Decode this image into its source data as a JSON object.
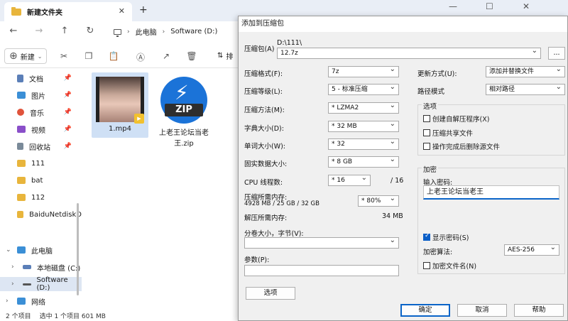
{
  "explorer": {
    "tab_title": "新建文件夹",
    "tab_close": "✕",
    "tab_add": "+",
    "win_min": "—",
    "win_max": "☐",
    "win_close": "✕",
    "nav": {
      "back": "←",
      "forward": "→",
      "up": "↑",
      "refresh": "↻"
    },
    "breadcrumb": [
      "此电脑",
      "Software (D:)"
    ],
    "breadcrumb_sep": "›",
    "toolbar": {
      "new_label": "新建",
      "sort_label": "排"
    },
    "sidebar": [
      {
        "label": "文档",
        "color": "#5b7fb8"
      },
      {
        "label": "图片",
        "color": "#3b8fd6"
      },
      {
        "label": "音乐",
        "color": "#e0533b"
      },
      {
        "label": "视频",
        "color": "#8a4fc9"
      },
      {
        "label": "回收站",
        "color": "#7a8a99"
      },
      {
        "label": "111",
        "color": "#e8b53c"
      },
      {
        "label": "bat",
        "color": "#e8b53c"
      },
      {
        "label": "112",
        "color": "#e8b53c"
      },
      {
        "label": "BaiduNetdiskD",
        "color": "#e8b53c"
      },
      {
        "label": "此电脑",
        "color": "#3b8fd6"
      },
      {
        "label": "本地磁盘 (C:)",
        "color": "#5b7fb8"
      },
      {
        "label": "Software (D:)",
        "color": "#555555"
      },
      {
        "label": "网络",
        "color": "#3b8fd6"
      }
    ],
    "files": [
      {
        "name": "1.mp4",
        "badge": "▶"
      },
      {
        "name": "上老王论坛当老王.zip",
        "zip_text": "ZIP",
        "bolt": "⚡"
      }
    ],
    "status": {
      "count": "2 个项目",
      "selection": "选中 1 个项目 601 MB"
    }
  },
  "dialog": {
    "title": "添加到压缩包",
    "close": "✕",
    "archive_label": "压缩包(A)",
    "archive_path": "D:\\111\\",
    "archive_name": "12.7z",
    "browse": "...",
    "format_label": "压缩格式(F):",
    "format_value": "7z",
    "level_label": "压缩等级(L):",
    "level_value": "5 - 标准压缩",
    "method_label": "压缩方法(M):",
    "method_value": "* LZMA2",
    "dict_label": "字典大小(D):",
    "dict_value": "* 32 MB",
    "word_label": "单词大小(W):",
    "word_value": "* 32",
    "solid_label": "固实数据大小:",
    "solid_value": "* 8 GB",
    "cpu_label": "CPU 线程数:",
    "cpu_value": "* 16",
    "cpu_total": "/ 16",
    "mem_c_label": "压缩所需内存:",
    "mem_c_detail": "4928 MB / 25 GB / 32 GB",
    "mem_c_value": "* 80%",
    "mem_d_label": "解压所需内存:",
    "mem_d_value": "34 MB",
    "split_label": "分卷大小，字节(V):",
    "split_value": "",
    "params_label": "参数(P):",
    "params_value": "",
    "options_btn": "选项",
    "update_label": "更新方式(U):",
    "update_value": "添加并替换文件",
    "path_label": "路径模式",
    "path_value": "相对路径",
    "options_group": "选项",
    "opt_sfx": "创建自解压程序(X)",
    "opt_shared": "压缩共享文件",
    "opt_delete": "操作完成后删除源文件",
    "enc_group": "加密",
    "pwd_label": "输入密码:",
    "pwd_value": "上老王论坛当老王",
    "show_pwd": "显示密码(S)",
    "enc_method_label": "加密算法:",
    "enc_method_value": "AES-256",
    "enc_names": "加密文件名(N)",
    "ok": "确定",
    "cancel": "取消",
    "help": "帮助"
  }
}
